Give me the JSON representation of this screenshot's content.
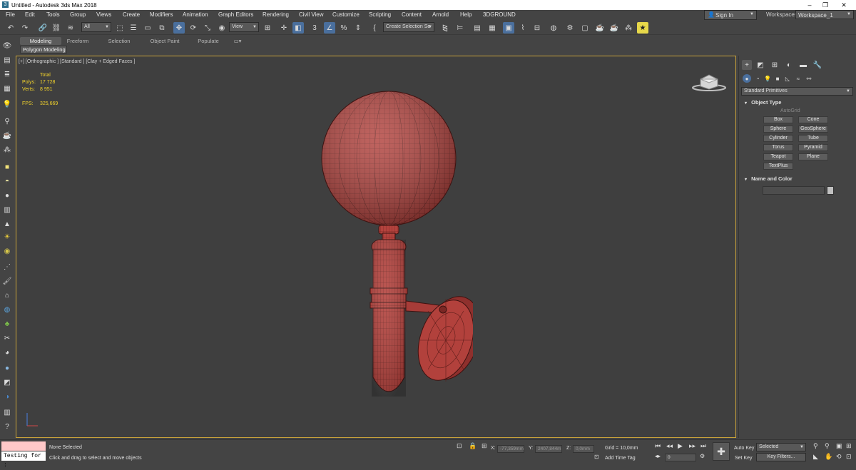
{
  "window": {
    "title": "Untitled - Autodesk 3ds Max 2018"
  },
  "menu": [
    "File",
    "Edit",
    "Tools",
    "Group",
    "Views",
    "Create",
    "Modifiers",
    "Animation",
    "Graph Editors",
    "Rendering",
    "Civil View",
    "Customize",
    "Scripting",
    "Content",
    "Arnold",
    "Help",
    "3DGROUND"
  ],
  "account": {
    "signin_label": "Sign In",
    "workspaces_label": "Workspaces:",
    "workspace_value": "Workspace_1"
  },
  "toolbar": {
    "filter_value": "All",
    "refcoord_value": "View",
    "selection_set_value": "Create Selection Se"
  },
  "ribbon": {
    "tabs": [
      "Modeling",
      "Freeform",
      "Selection",
      "Object Paint",
      "Populate"
    ],
    "active_tab": "Modeling",
    "panel_label": "Polygon Modeling"
  },
  "viewport": {
    "label": "[+] [Orthographic ] [Standard ] [Clay + Edged Faces ]",
    "stats": {
      "total_label": "Total",
      "polys_label": "Polys:",
      "polys_value": "17 728",
      "verts_label": "Verts:",
      "verts_value": "8 951",
      "fps_label": "FPS:",
      "fps_value": "325,669"
    },
    "model_color": "#b2413c"
  },
  "command_panel": {
    "category": "Standard Primitives",
    "object_type_header": "Object Type",
    "autogrid_label": "AutoGrid",
    "buttons": [
      "Box",
      "Cone",
      "Sphere",
      "GeoSphere",
      "Cylinder",
      "Tube",
      "Torus",
      "Pyramid",
      "Teapot",
      "Plane",
      "TextPlus"
    ],
    "name_color_header": "Name and Color"
  },
  "status": {
    "maxscript_text": "Testing for :",
    "selection": "None Selected",
    "prompt": "Click and drag to select and move objects",
    "x_label": "X:",
    "x_value": "-77,359mm",
    "y_label": "Y:",
    "y_value": "2407,844m",
    "z_label": "Z:",
    "z_value": "0,0mm",
    "grid": "Grid = 10,0mm",
    "add_time_tag": "Add Time Tag",
    "auto_key": "Auto Key",
    "set_key": "Set Key",
    "selected_value": "Selected",
    "key_filters": "Key Filters...",
    "frame_value": "0"
  }
}
